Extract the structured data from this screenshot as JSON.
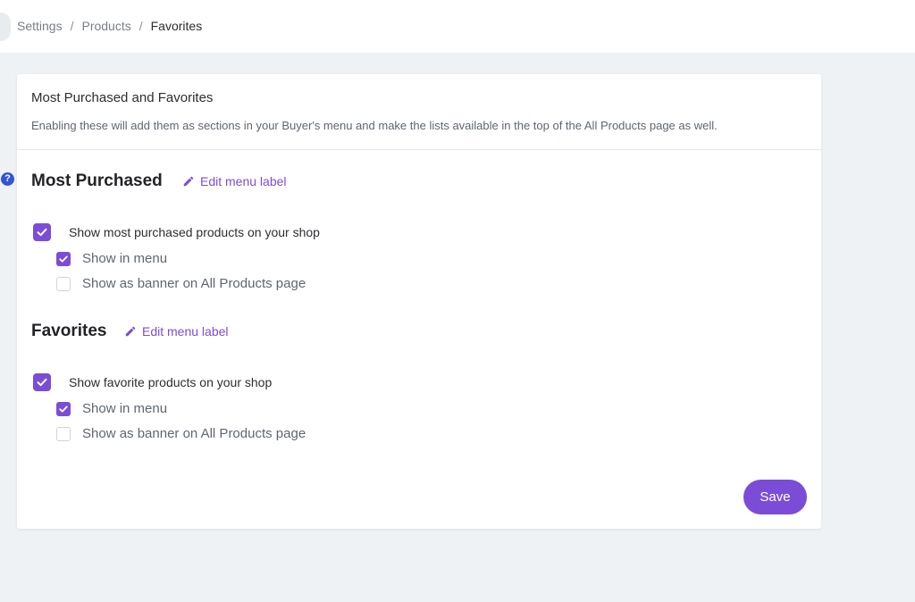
{
  "breadcrumb": [
    "Settings",
    "Products",
    "Favorites"
  ],
  "breadcrumb_separator": "/",
  "card": {
    "title": "Most Purchased and Favorites",
    "description": "Enabling these will add them as sections in your Buyer's menu and make the lists available in the top of the All Products page as well."
  },
  "help_icon_glyph": "?",
  "sections": [
    {
      "title": "Most Purchased",
      "edit_label": "Edit menu label",
      "main_option": {
        "label": "Show most purchased products on your shop",
        "checked": true
      },
      "sub_options": [
        {
          "label": "Show in menu",
          "checked": true
        },
        {
          "label": "Show as banner on All Products page",
          "checked": false
        }
      ]
    },
    {
      "title": "Favorites",
      "edit_label": "Edit menu label",
      "main_option": {
        "label": "Show favorite products on your shop",
        "checked": true
      },
      "sub_options": [
        {
          "label": "Show in menu",
          "checked": true
        },
        {
          "label": "Show as banner on All Products page",
          "checked": false
        }
      ]
    }
  ],
  "save_label": "Save",
  "colors": {
    "accent": "#7b4dd6",
    "help": "#3553d8",
    "background": "#eff2f5"
  },
  "icons": {
    "edit": "pencil-icon",
    "help": "question-icon",
    "check": "checkmark-icon"
  }
}
